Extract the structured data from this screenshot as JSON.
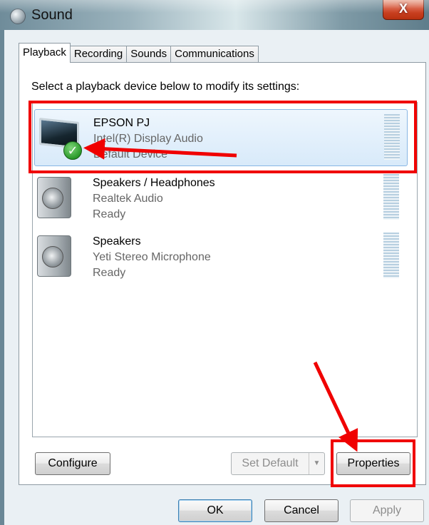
{
  "window": {
    "title": "Sound",
    "close_label": "X",
    "app_icon": "sound-icon"
  },
  "tabs": [
    {
      "label": "Playback",
      "active": true
    },
    {
      "label": "Recording",
      "active": false
    },
    {
      "label": "Sounds",
      "active": false
    },
    {
      "label": "Communications",
      "active": false
    }
  ],
  "playback": {
    "instruction": "Select a playback device below to modify its settings:",
    "devices": [
      {
        "name": "EPSON PJ",
        "driver": "Intel(R) Display Audio",
        "status": "Default Device",
        "icon": "monitor-icon",
        "badge": "check-icon",
        "selected": true
      },
      {
        "name": "Speakers / Headphones",
        "driver": "Realtek Audio",
        "status": "Ready",
        "icon": "speaker-icon",
        "selected": false
      },
      {
        "name": "Speakers",
        "driver": "Yeti Stereo Microphone",
        "status": "Ready",
        "icon": "speaker-icon",
        "selected": false
      }
    ],
    "configure_label": "Configure",
    "set_default_label": "Set Default",
    "properties_label": "Properties"
  },
  "dialog_buttons": {
    "ok": "OK",
    "cancel": "Cancel",
    "apply": "Apply"
  },
  "colors": {
    "annotation": "#f00000",
    "selection": "#d8eafa"
  }
}
